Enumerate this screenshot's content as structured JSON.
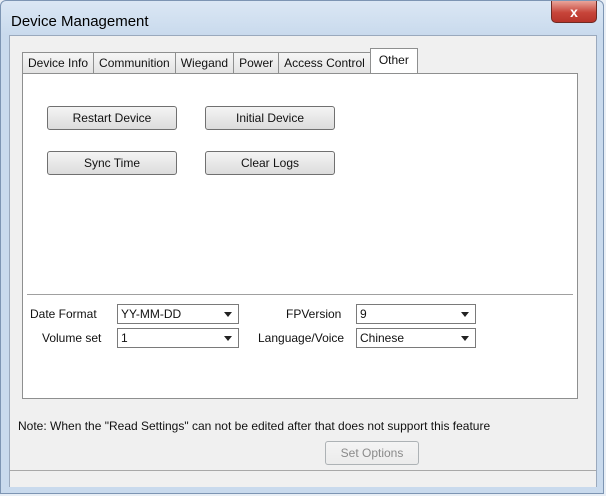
{
  "window": {
    "title": "Device Management",
    "close_glyph": "x"
  },
  "tabs": [
    {
      "label": "Device Info"
    },
    {
      "label": "Communition"
    },
    {
      "label": "Wiegand"
    },
    {
      "label": "Power"
    },
    {
      "label": "Access Control"
    },
    {
      "label": "Other",
      "active": true
    }
  ],
  "actions": {
    "restart": "Restart Device",
    "initial": "Initial Device",
    "sync": "Sync Time",
    "clear_logs": "Clear Logs"
  },
  "settings": {
    "date_format": {
      "label": "Date Format",
      "value": "YY-MM-DD"
    },
    "volume": {
      "label": "Volume set",
      "value": "1"
    },
    "fp_version": {
      "label": "FPVersion",
      "value": "9"
    },
    "language": {
      "label": "Language/Voice",
      "value": "Chinese"
    }
  },
  "note": "Note: When the \"Read Settings\" can not be edited after that does not support this feature",
  "set_options": "Set Options",
  "icons": {
    "close": "close-icon",
    "dropdown": "chevron-down-icon"
  }
}
